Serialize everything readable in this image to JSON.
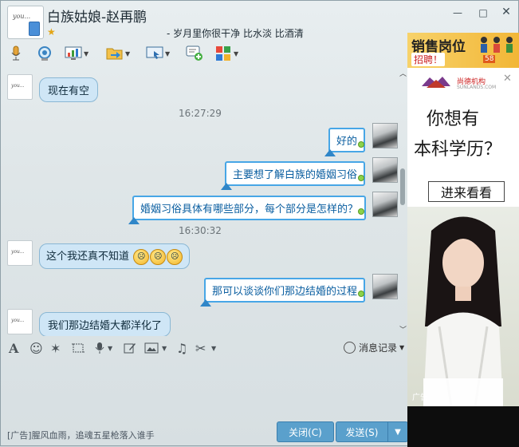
{
  "window": {
    "title": "白族姑娘-赵再鹏",
    "signature": "- 岁月里你很干净 比水淡 比酒清",
    "avatar_text": "you...",
    "controls": {
      "minimize": "—",
      "maximize": "□",
      "close": "✕"
    }
  },
  "toolbar": {
    "items": [
      {
        "name": "voice-call",
        "icon": "microphone-icon"
      },
      {
        "name": "video-call",
        "icon": "camera-icon"
      },
      {
        "name": "app",
        "icon": "chart-icon"
      },
      {
        "name": "file-transfer",
        "icon": "folder-arrow-icon"
      },
      {
        "name": "remote-assist",
        "icon": "monitor-icon"
      },
      {
        "name": "create-discussion",
        "icon": "chat-add-icon"
      },
      {
        "name": "apps",
        "icon": "grid-icon"
      }
    ]
  },
  "chat": {
    "messages": [
      {
        "side": "left",
        "text": "现在有空"
      },
      {
        "type": "time",
        "text": "16:27:29"
      },
      {
        "side": "right",
        "text": "好的"
      },
      {
        "side": "right",
        "text": "主要想了解白族的婚姻习俗"
      },
      {
        "side": "right",
        "text": "婚姻习俗具体有哪些部分，每个部分是怎样的？"
      },
      {
        "type": "time",
        "text": "16:30:32"
      },
      {
        "side": "left",
        "text": "这个我还真不知道"
      },
      {
        "side": "right",
        "text": "那可以谈谈你们那边结婚的过程"
      },
      {
        "side": "left",
        "text": "我们那边结婚大都洋化了"
      }
    ]
  },
  "format_bar": {
    "history_label": "消息记录"
  },
  "footer": {
    "ad_text": "[广告]腥风血雨，追魂五星枪落入谁手",
    "close_label": "关闭(C)",
    "send_label": "发送(S)",
    "send_arrow": "▼"
  },
  "ad": {
    "banner_title": "销售岗位",
    "banner_sub": "招聘！",
    "banner_site": "58",
    "logo_text": "尚德机构",
    "logo_sub": "SUNLANDS.COM",
    "question_1": "你想有",
    "question_2": "本科学历？",
    "cta": "进来看看",
    "label": "广告",
    "close": "✕"
  }
}
